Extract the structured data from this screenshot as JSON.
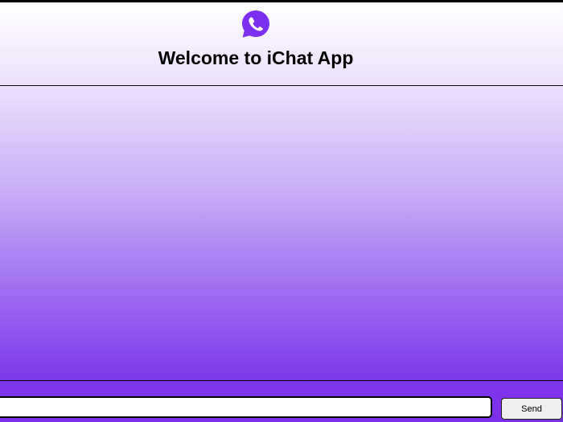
{
  "header": {
    "logo_icon": "whatsapp-phone-chat-icon",
    "title": "Welcome to iChat App"
  },
  "chat": {
    "messages": []
  },
  "composer": {
    "input_value": "",
    "input_placeholder": "",
    "send_label": "Send"
  },
  "colors": {
    "accent": "#7a2fe9",
    "logo": "#7b2ff0"
  }
}
